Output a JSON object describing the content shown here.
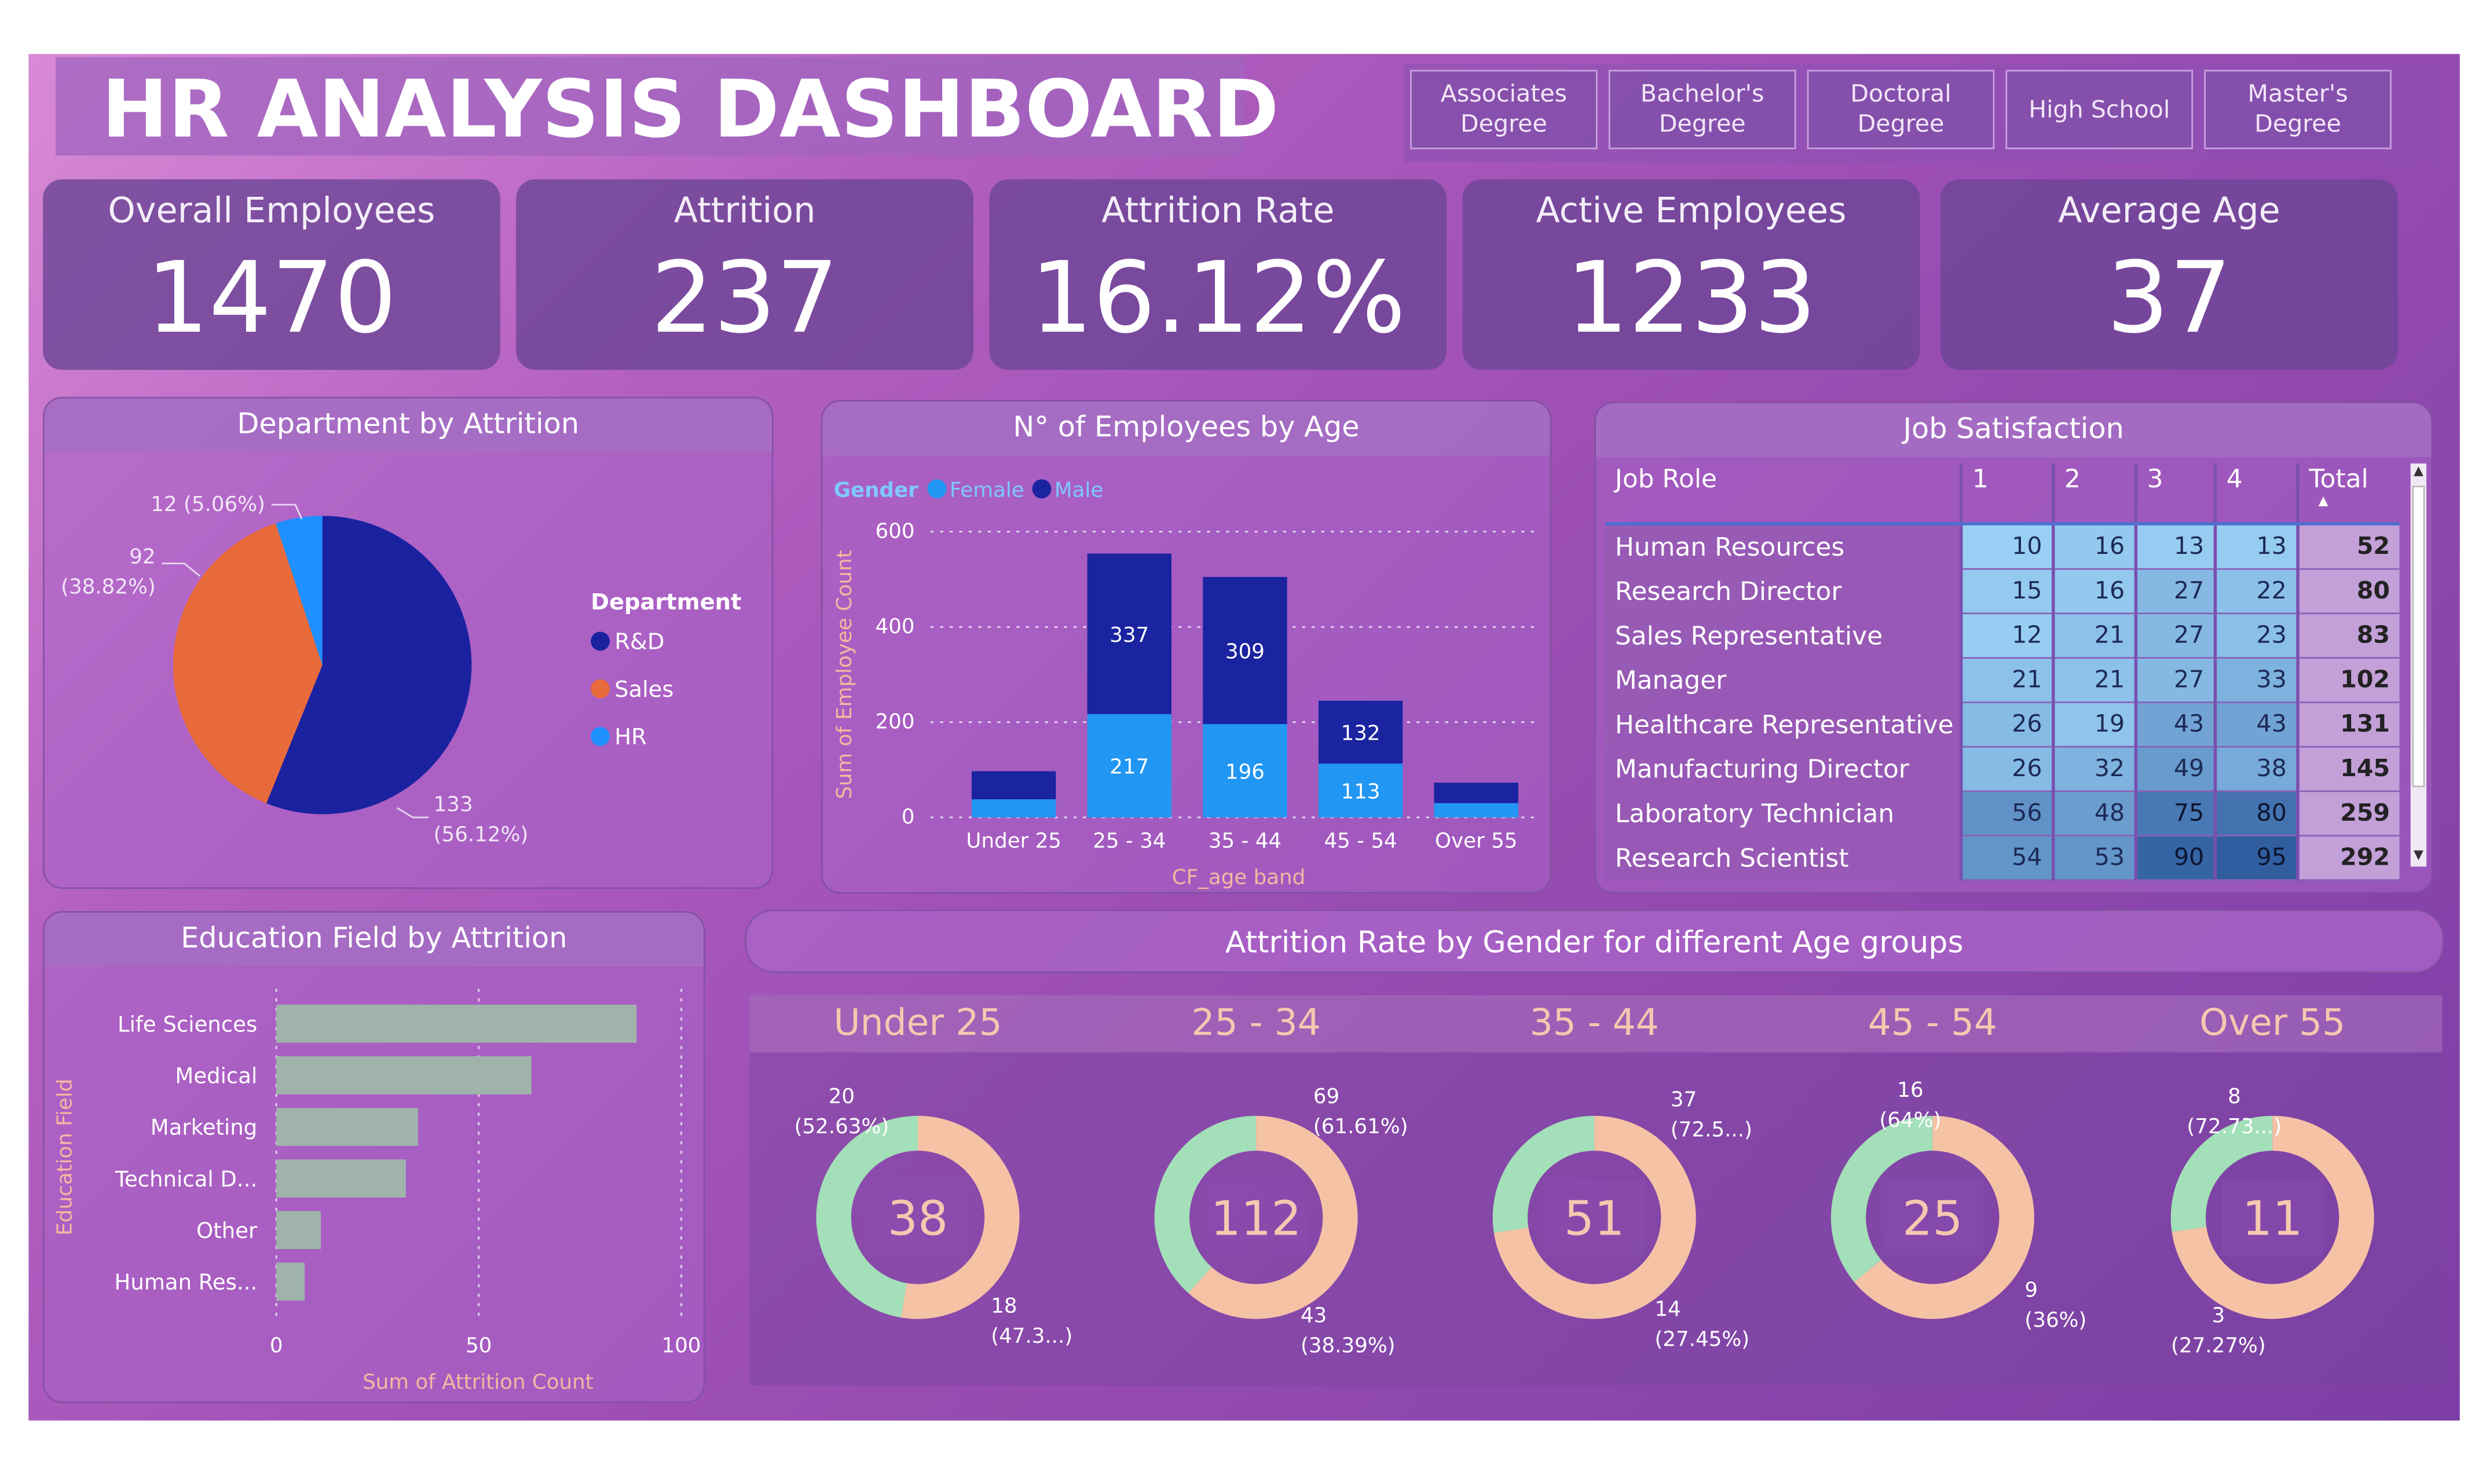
{
  "title": "HR ANALYSIS DASHBOARD",
  "slicers": [
    "Associates\nDegree",
    "Bachelor's\nDegree",
    "Doctoral\nDegree",
    "High School",
    "Master's\nDegree"
  ],
  "kpis": [
    {
      "label": "Overall Employees",
      "value": "1470"
    },
    {
      "label": "Attrition",
      "value": "237"
    },
    {
      "label": "Attrition Rate",
      "value": "16.12%"
    },
    {
      "label": "Active Employees",
      "value": "1233"
    },
    {
      "label": "Average Age",
      "value": "37"
    }
  ],
  "colors": {
    "rd": "#1a22a0",
    "sales": "#e8693a",
    "hr": "#1e90ff",
    "female": "#2196f3",
    "male": "#1a23a0",
    "bar": "#9fb3ab",
    "donut_green": "#a3dfb8",
    "donut_peach": "#f6c2a6"
  },
  "dept": {
    "title": "Department by Attrition",
    "legend_title": "Department",
    "items": [
      {
        "name": "R&D",
        "value": 133,
        "label1": "133",
        "label2": "(56.12%)"
      },
      {
        "name": "Sales",
        "value": 92,
        "label1": "92",
        "label2": "(38.82%)"
      },
      {
        "name": "HR",
        "value": 12,
        "label1": "12 (5.06%)",
        "label2": ""
      }
    ]
  },
  "age_chart": {
    "title": "N° of Employees by Age",
    "legend_title": "Gender",
    "legend": [
      "Female",
      "Male"
    ],
    "ylabel": "Sum of Employee Count",
    "xlabel": "CF_age band",
    "yticks": [
      0,
      200,
      400,
      600
    ]
  },
  "job_sat": {
    "title": "Job Satisfaction",
    "headers": [
      "Job Role",
      "1",
      "2",
      "3",
      "4",
      "Total"
    ],
    "rows": [
      [
        "Human Resources",
        "10",
        "16",
        "13",
        "13",
        "52"
      ],
      [
        "Research Director",
        "15",
        "16",
        "27",
        "22",
        "80"
      ],
      [
        "Sales Representative",
        "12",
        "21",
        "27",
        "23",
        "83"
      ],
      [
        "Manager",
        "21",
        "21",
        "27",
        "33",
        "102"
      ],
      [
        "Healthcare Representative",
        "26",
        "19",
        "43",
        "43",
        "131"
      ],
      [
        "Manufacturing Director",
        "26",
        "32",
        "49",
        "38",
        "145"
      ],
      [
        "Laboratory Technician",
        "56",
        "48",
        "75",
        "80",
        "259"
      ],
      [
        "Research Scientist",
        "54",
        "53",
        "90",
        "95",
        "292"
      ]
    ]
  },
  "edu": {
    "title": "Education Field by Attrition",
    "ylabel": "Education Field",
    "xlabel": "Sum of Attrition Count",
    "xticks": [
      "0",
      "50",
      "100"
    ]
  },
  "gender_age": {
    "title": "Attrition Rate by Gender for different Age groups",
    "groups": [
      {
        "name": "Under 25",
        "total": "38",
        "top1": "20",
        "top2": "(52.63%)",
        "bot1": "18",
        "bot2": "(47.3...)"
      },
      {
        "name": "25 - 34",
        "total": "112",
        "top1": "69",
        "top2": "(61.61%)",
        "bot1": "43",
        "bot2": "(38.39%)"
      },
      {
        "name": "35 - 44",
        "total": "51",
        "top1": "37",
        "top2": "(72.5...)",
        "bot1": "14",
        "bot2": "(27.45%)"
      },
      {
        "name": "45 - 54",
        "total": "25",
        "top1": "16",
        "top2": "(64%)",
        "bot1": "9",
        "bot2": "(36%)"
      },
      {
        "name": "Over 55",
        "total": "11",
        "top1": "8",
        "top2": "(72.73...)",
        "bot1": "3",
        "bot2": "(27.27%)"
      }
    ]
  },
  "chart_data": [
    {
      "type": "pie",
      "title": "Department by Attrition",
      "categories": [
        "R&D",
        "Sales",
        "HR"
      ],
      "values": [
        133,
        92,
        12
      ],
      "percent": [
        56.12,
        38.82,
        5.06
      ],
      "legend": "right"
    },
    {
      "type": "bar",
      "stacked": true,
      "title": "N° of Employees by Age",
      "categories": [
        "Under 25",
        "25 - 34",
        "35 - 44",
        "45 - 54",
        "Over 55"
      ],
      "series": [
        {
          "name": "Female",
          "values": [
            38,
            217,
            196,
            113,
            30
          ]
        },
        {
          "name": "Male",
          "values": [
            59,
            337,
            309,
            132,
            43
          ]
        }
      ],
      "data_labels": {
        "Female": [
          "",
          "217",
          "196",
          "113",
          ""
        ],
        "Male": [
          "",
          "337",
          "309",
          "132",
          ""
        ]
      },
      "xlabel": "CF_age band",
      "ylabel": "Sum of Employee Count",
      "ylim": [
        0,
        600
      ],
      "grid": true,
      "legend": "top-left"
    },
    {
      "type": "bar",
      "orientation": "horizontal",
      "title": "Education Field by Attrition",
      "categories": [
        "Life Sciences",
        "Medical",
        "Marketing",
        "Technical D...",
        "Other",
        "Human Res..."
      ],
      "values": [
        89,
        63,
        35,
        32,
        11,
        7
      ],
      "xlabel": "Sum of Attrition Count",
      "ylabel": "Education Field",
      "xlim": [
        0,
        100
      ],
      "grid": true
    },
    {
      "type": "pie",
      "variant": "donut",
      "title": "Attrition Rate by Gender for different Age groups",
      "groups": [
        {
          "name": "Under 25",
          "values": [
            20,
            18
          ],
          "total": 38
        },
        {
          "name": "25 - 34",
          "values": [
            69,
            43
          ],
          "total": 112
        },
        {
          "name": "35 - 44",
          "values": [
            37,
            14
          ],
          "total": 51
        },
        {
          "name": "45 - 54",
          "values": [
            16,
            9
          ],
          "total": 25
        },
        {
          "name": "Over 55",
          "values": [
            8,
            3
          ],
          "total": 11
        }
      ]
    }
  ]
}
